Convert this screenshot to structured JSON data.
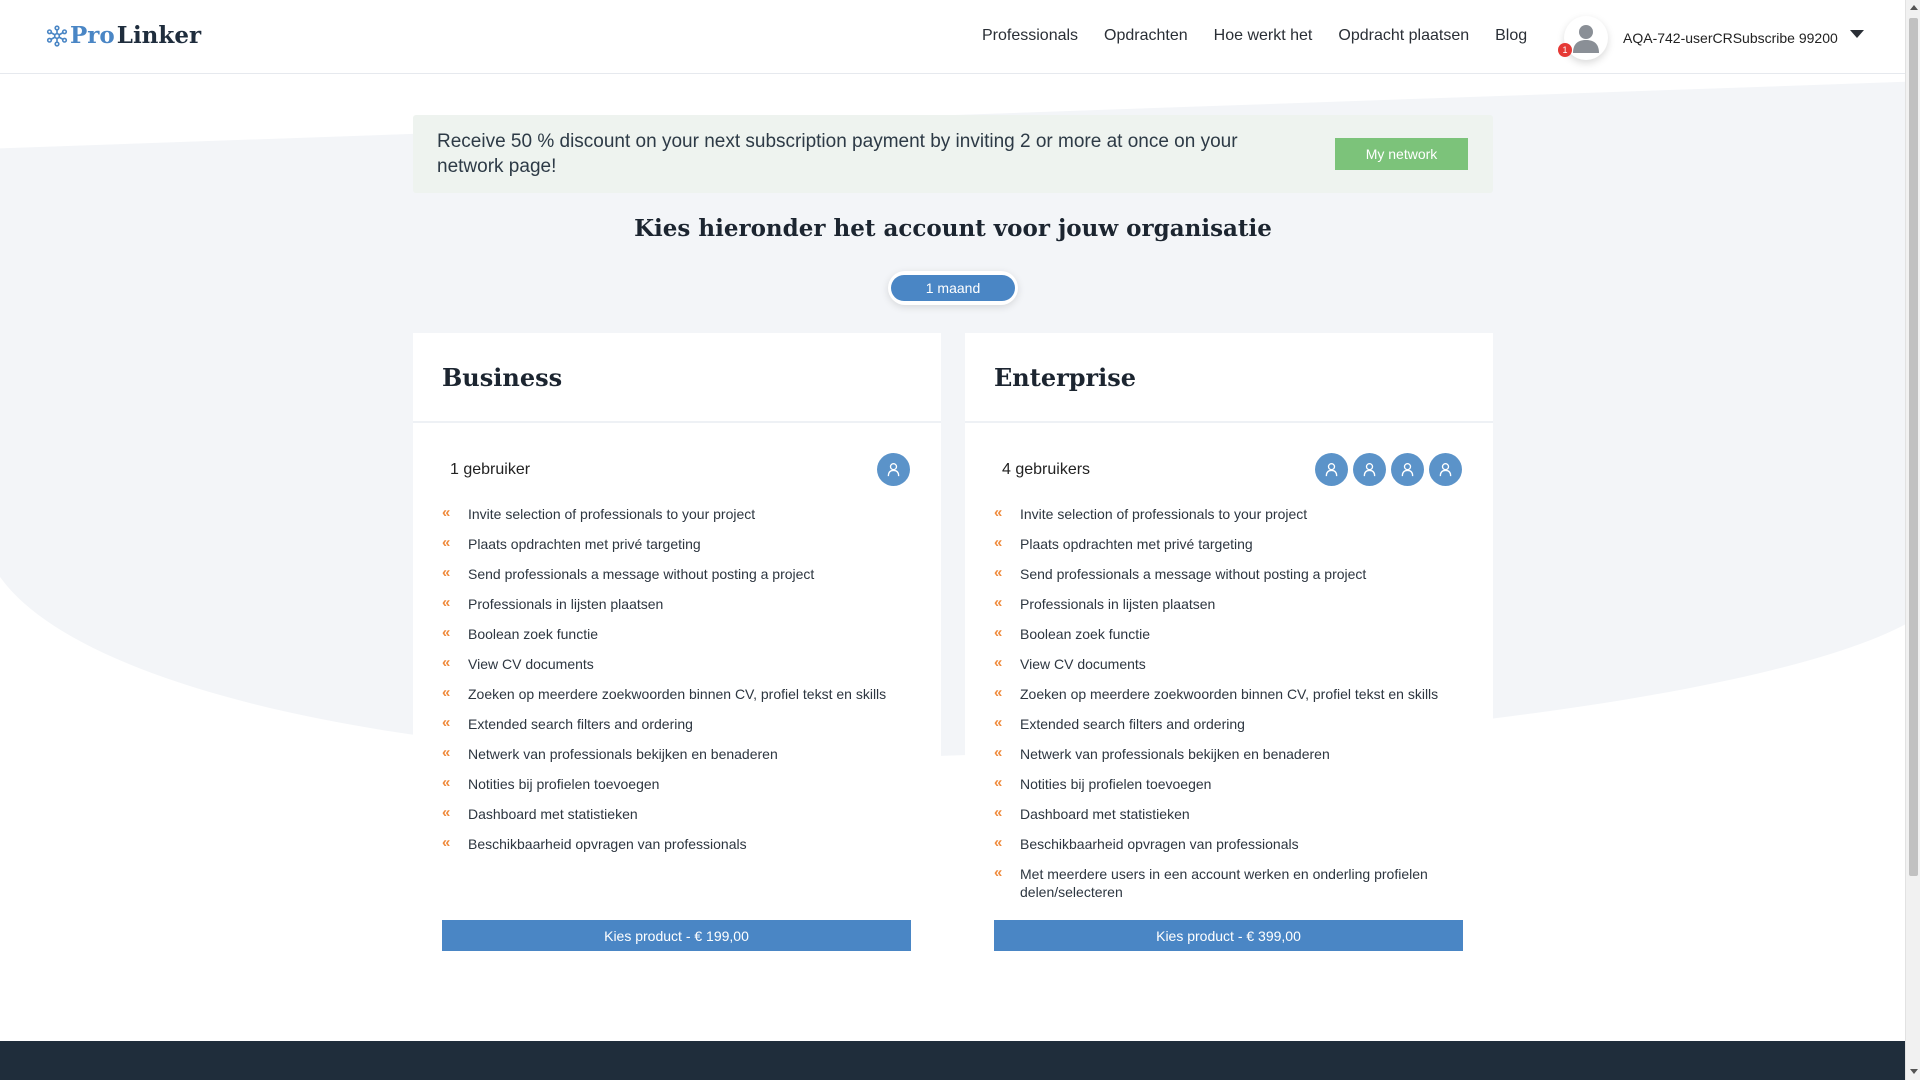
{
  "header": {
    "logo_pro": "Pro",
    "logo_linker": "Linker",
    "nav": [
      "Professionals",
      "Opdrachten",
      "Hoe werkt het",
      "Opdracht plaatsen",
      "Blog"
    ],
    "notification_count": "1",
    "username": "AQA-742-userCRSubscribe 99200"
  },
  "banner": {
    "text": "Receive 50 % discount on your next subscription payment by inviting 2 or more at once on your network page!",
    "button": "My network"
  },
  "page_title": "Kies hieronder het account voor jouw organisatie",
  "period_toggle": "1 maand",
  "plans": [
    {
      "name": "Business",
      "users_label": "1 gebruiker",
      "user_count": 1,
      "features": [
        "Invite selection of professionals to your project",
        "Plaats opdrachten met privé targeting",
        "Send professionals a message without posting a project",
        "Professionals in lijsten plaatsen",
        "Boolean zoek functie",
        "View CV documents",
        "Zoeken op meerdere zoekwoorden binnen CV, profiel tekst en skills",
        "Extended search filters and ordering",
        "Netwerk van professionals bekijken en benaderen",
        "Notities bij profielen toevoegen",
        "Dashboard met statistieken",
        "Beschikbaarheid opvragen van professionals"
      ],
      "button": "Kies product - € 199,00"
    },
    {
      "name": "Enterprise",
      "users_label": "4 gebruikers",
      "user_count": 4,
      "features": [
        "Invite selection of professionals to your project",
        "Plaats opdrachten met privé targeting",
        "Send professionals a message without posting a project",
        "Professionals in lijsten plaatsen",
        "Boolean zoek functie",
        "View CV documents",
        "Zoeken op meerdere zoekwoorden binnen CV, profiel tekst en skills",
        "Extended search filters and ordering",
        "Netwerk van professionals bekijken en benaderen",
        "Notities bij profielen toevoegen",
        "Dashboard met statistieken",
        "Beschikbaarheid opvragen van professionals",
        "Met meerdere users in een account werken en onderling profielen delen/selecteren"
      ],
      "button": "Kies product - € 399,00"
    }
  ],
  "colors": {
    "accent": "#4a86c5",
    "success": "#7cc37a",
    "bullet": "#ef8a3c",
    "footer": "#1f2d3b"
  }
}
